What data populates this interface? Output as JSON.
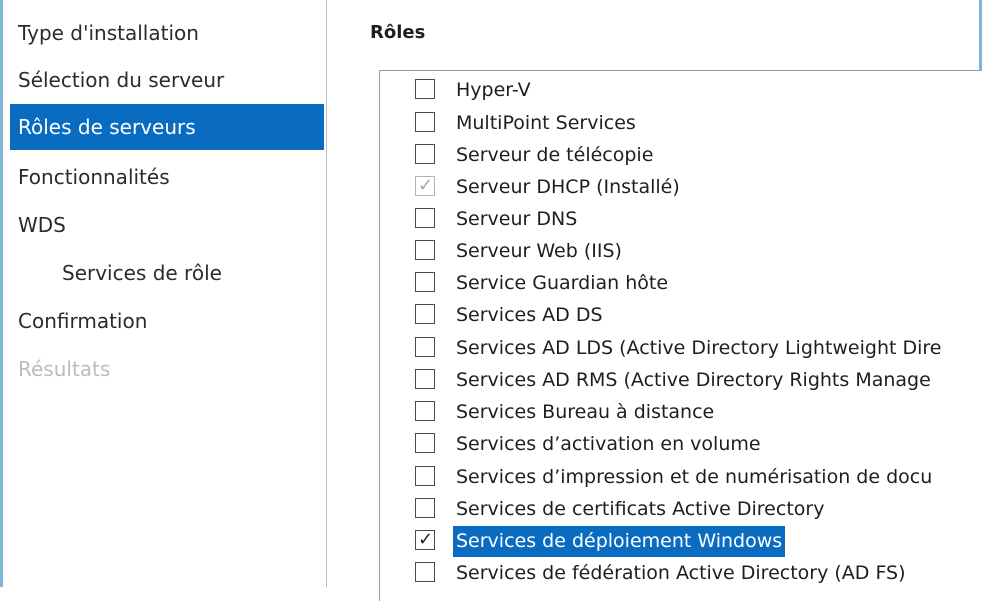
{
  "sidebar": {
    "items": [
      {
        "label": "Type d'installation",
        "state": "normal"
      },
      {
        "label": "Sélection du serveur",
        "state": "normal"
      },
      {
        "label": "Rôles de serveurs",
        "state": "active"
      },
      {
        "label": "Fonctionnalités",
        "state": "normal"
      },
      {
        "label": "WDS",
        "state": "normal"
      },
      {
        "label": "Services de rôle",
        "state": "sub"
      },
      {
        "label": "Confirmation",
        "state": "normal"
      },
      {
        "label": "Résultats",
        "state": "disabled"
      }
    ]
  },
  "main": {
    "title": "Rôles",
    "roles": [
      {
        "label": "Hyper-V",
        "checked": false,
        "disabled": false,
        "selected": false
      },
      {
        "label": "MultiPoint Services",
        "checked": false,
        "disabled": false,
        "selected": false
      },
      {
        "label": "Serveur de télécopie",
        "checked": false,
        "disabled": false,
        "selected": false
      },
      {
        "label": "Serveur DHCP (Installé)",
        "checked": true,
        "disabled": true,
        "selected": false
      },
      {
        "label": "Serveur DNS",
        "checked": false,
        "disabled": false,
        "selected": false
      },
      {
        "label": "Serveur Web (IIS)",
        "checked": false,
        "disabled": false,
        "selected": false
      },
      {
        "label": "Service Guardian hôte",
        "checked": false,
        "disabled": false,
        "selected": false
      },
      {
        "label": "Services AD DS",
        "checked": false,
        "disabled": false,
        "selected": false
      },
      {
        "label": "Services AD LDS (Active Directory Lightweight Dire",
        "checked": false,
        "disabled": false,
        "selected": false
      },
      {
        "label": "Services AD RMS (Active Directory Rights Manage",
        "checked": false,
        "disabled": false,
        "selected": false
      },
      {
        "label": "Services Bureau à distance",
        "checked": false,
        "disabled": false,
        "selected": false
      },
      {
        "label": "Services d’activation en volume",
        "checked": false,
        "disabled": false,
        "selected": false
      },
      {
        "label": "Services d’impression et de numérisation de docu",
        "checked": false,
        "disabled": false,
        "selected": false
      },
      {
        "label": "Services de certificats Active Directory",
        "checked": false,
        "disabled": false,
        "selected": false
      },
      {
        "label": "Services de déploiement Windows",
        "checked": true,
        "disabled": false,
        "selected": true
      },
      {
        "label": "Services de fédération Active Directory (AD FS)",
        "checked": false,
        "disabled": false,
        "selected": false
      }
    ]
  },
  "colors": {
    "accent": "#0a6cc1",
    "frame": "#7fb3d8",
    "disabled_text": "#bcbcbc"
  },
  "icons": {
    "checkmark": "check-icon"
  }
}
